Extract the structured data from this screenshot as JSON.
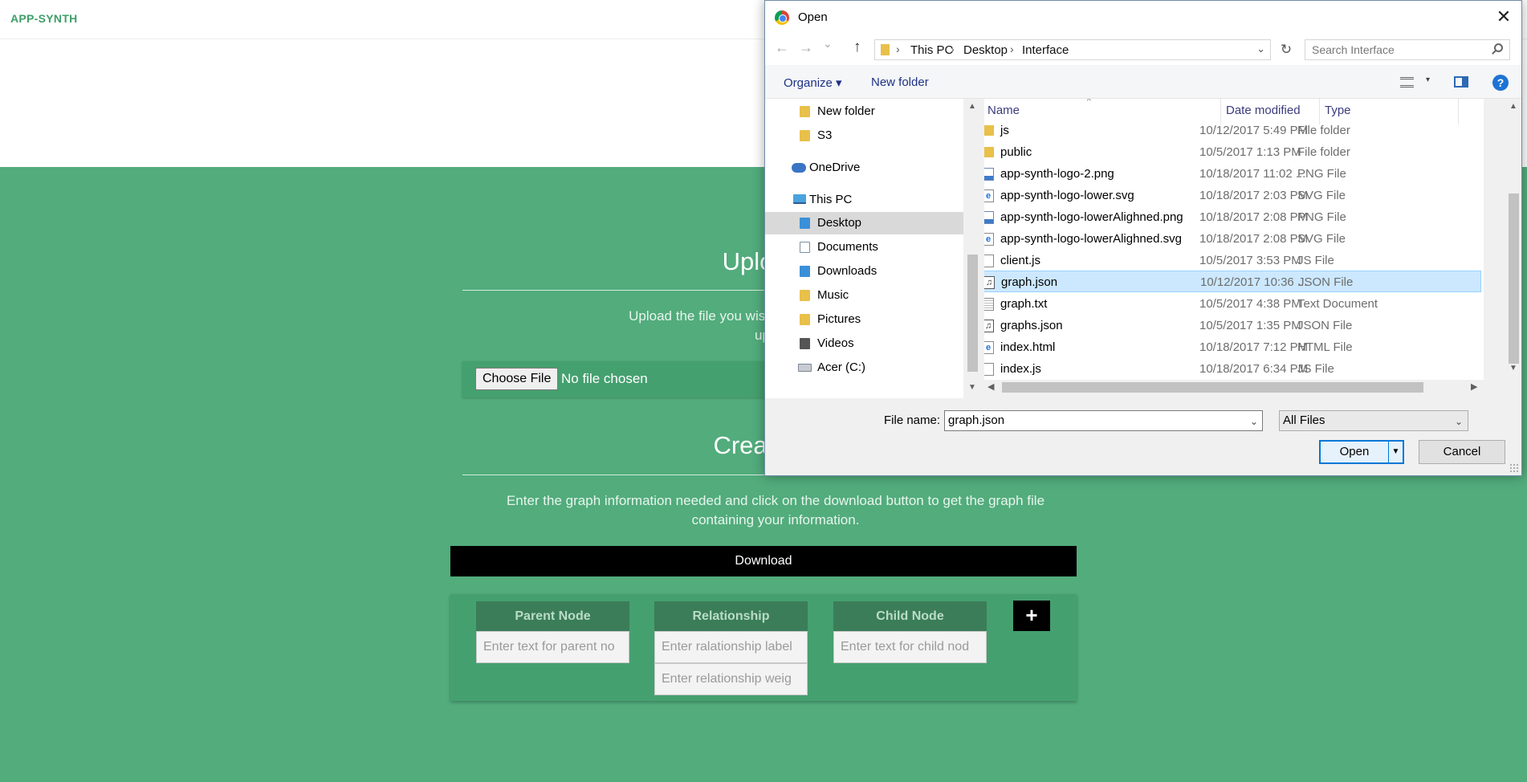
{
  "app": {
    "brand": "APP-SYNTH"
  },
  "upload": {
    "title": "Upload Fi",
    "description_line1": "Upload the file you wish to edit and change the fi",
    "description_line2": "update",
    "choose_file_label": "Choose File",
    "file_status": "No file chosen"
  },
  "create": {
    "title": "Create/Edit",
    "description_line1": "Enter the graph information needed and click on the download button to get the graph file",
    "description_line2": "containing your information.",
    "download_label": "Download",
    "add_label": "+",
    "columns": {
      "parent": {
        "header": "Parent Node",
        "placeholder": "Enter text for parent no"
      },
      "relationship": {
        "header": "Relationship",
        "label_placeholder": "Enter ralationship label",
        "weight_placeholder": "Enter relationship weig"
      },
      "child": {
        "header": "Child Node",
        "placeholder": "Enter text for child nod"
      }
    }
  },
  "dialog": {
    "title": "Open",
    "close_glyph": "✕",
    "nav": {
      "back": "←",
      "forward": "→",
      "recent": "⌄",
      "up": "↑",
      "refresh": "↻",
      "address_dropdown": "⌄"
    },
    "breadcrumb": [
      "This PC",
      "Desktop",
      "Interface"
    ],
    "search_placeholder": "Search Interface",
    "toolbar": {
      "organize": "Organize ▾",
      "new_folder": "New folder",
      "view_dropdown": "▾",
      "help": "?"
    },
    "nav_pane": [
      {
        "label": "New folder",
        "icon": "folder-icon"
      },
      {
        "label": "S3",
        "icon": "folder-icon"
      },
      {
        "label": "OneDrive",
        "icon": "onedrive-icon"
      },
      {
        "label": "This PC",
        "icon": "computer-icon"
      },
      {
        "label": "Desktop",
        "icon": "desktop-folder-icon",
        "selected": true
      },
      {
        "label": "Documents",
        "icon": "documents-icon"
      },
      {
        "label": "Downloads",
        "icon": "downloads-icon"
      },
      {
        "label": "Music",
        "icon": "music-icon"
      },
      {
        "label": "Pictures",
        "icon": "pictures-icon"
      },
      {
        "label": "Videos",
        "icon": "videos-icon"
      },
      {
        "label": "Acer (C:)",
        "icon": "drive-icon"
      }
    ],
    "columns": {
      "name": "Name",
      "date": "Date modified",
      "type": "Type",
      "sort_glyph": "^"
    },
    "files": [
      {
        "name": "js",
        "date": "10/12/2017 5:49 PM",
        "type": "File folder",
        "icon": "folder-icon"
      },
      {
        "name": "public",
        "date": "10/5/2017 1:13 PM",
        "type": "File folder",
        "icon": "folder-icon"
      },
      {
        "name": "app-synth-logo-2.png",
        "date": "10/18/2017 11:02 ...",
        "type": "PNG File",
        "icon": "image-file-icon"
      },
      {
        "name": "app-synth-logo-lower.svg",
        "date": "10/18/2017 2:03 PM",
        "type": "SVG File",
        "icon": "browser-file-icon"
      },
      {
        "name": "app-synth-logo-lowerAlighned.png",
        "date": "10/18/2017 2:08 PM",
        "type": "PNG File",
        "icon": "image-file-icon"
      },
      {
        "name": "app-synth-logo-lowerAlighned.svg",
        "date": "10/18/2017 2:08 PM",
        "type": "SVG File",
        "icon": "browser-file-icon"
      },
      {
        "name": "client.js",
        "date": "10/5/2017 3:53 PM",
        "type": "JS File",
        "icon": "file-icon"
      },
      {
        "name": "graph.json",
        "date": "10/12/2017 10:36 ...",
        "type": "JSON File",
        "icon": "json-file-icon",
        "selected": true
      },
      {
        "name": "graph.txt",
        "date": "10/5/2017 4:38 PM",
        "type": "Text Document",
        "icon": "text-file-icon"
      },
      {
        "name": "graphs.json",
        "date": "10/5/2017 1:35 PM",
        "type": "JSON File",
        "icon": "json-file-icon"
      },
      {
        "name": "index.html",
        "date": "10/18/2017 7:12 PM",
        "type": "HTML File",
        "icon": "browser-file-icon"
      },
      {
        "name": "index.js",
        "date": "10/18/2017 6:34 PM",
        "type": "JS File",
        "icon": "file-icon"
      }
    ],
    "file_name_label": "File name:",
    "file_name_value": "graph.json",
    "file_type": "All Files",
    "dropdown_glyph": "⌄",
    "scroll_glyphs": {
      "up": "▲",
      "down": "▼",
      "left": "◀",
      "right": "▶"
    },
    "open_label": "Open",
    "open_split_glyph": "▼",
    "cancel_label": "Cancel"
  }
}
